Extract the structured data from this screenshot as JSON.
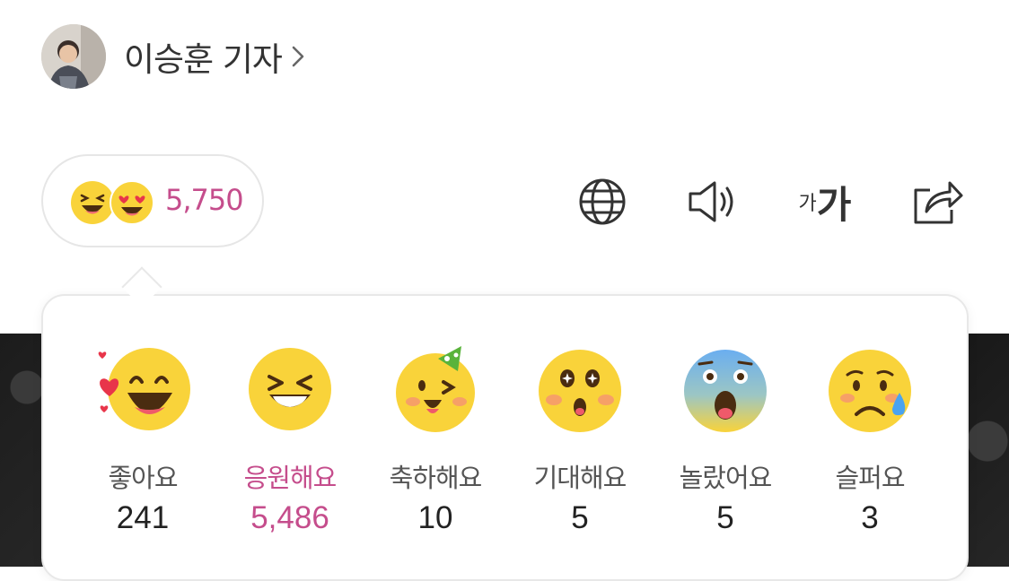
{
  "author": {
    "name": "이승훈 기자"
  },
  "reactions_summary": {
    "total": "5,750"
  },
  "toolbar": {
    "font_small": "가",
    "font_large": "가"
  },
  "reactions": [
    {
      "label": "좋아요",
      "count": "241"
    },
    {
      "label": "응원해요",
      "count": "5,486"
    },
    {
      "label": "축하해요",
      "count": "10"
    },
    {
      "label": "기대해요",
      "count": "5"
    },
    {
      "label": "놀랐어요",
      "count": "5"
    },
    {
      "label": "슬퍼요",
      "count": "3"
    }
  ],
  "colors": {
    "accent": "#c54d8c",
    "emoji_yellow": "#f9d33a",
    "border": "#e6e6e6"
  }
}
